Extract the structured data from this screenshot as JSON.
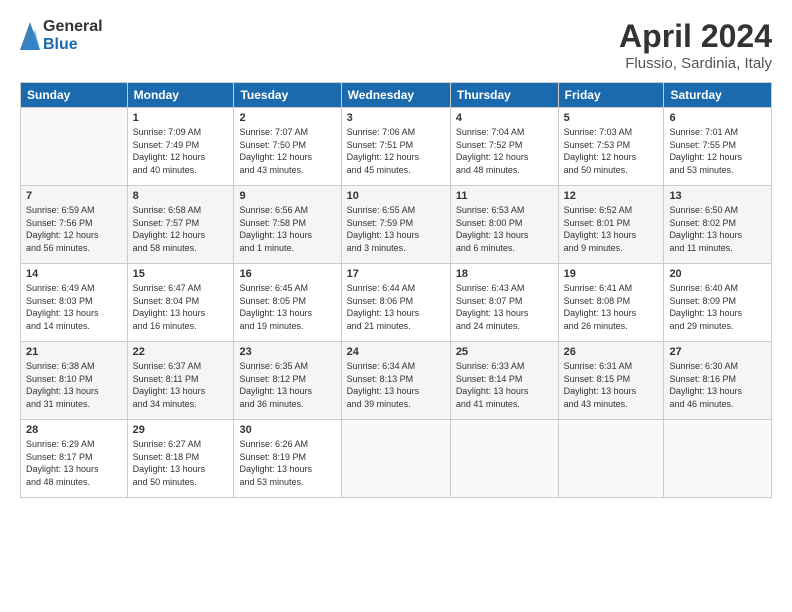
{
  "logo": {
    "general": "General",
    "blue": "Blue"
  },
  "title": "April 2024",
  "location": "Flussio, Sardinia, Italy",
  "days_header": [
    "Sunday",
    "Monday",
    "Tuesday",
    "Wednesday",
    "Thursday",
    "Friday",
    "Saturday"
  ],
  "weeks": [
    [
      {
        "day": "",
        "info": ""
      },
      {
        "day": "1",
        "info": "Sunrise: 7:09 AM\nSunset: 7:49 PM\nDaylight: 12 hours\nand 40 minutes."
      },
      {
        "day": "2",
        "info": "Sunrise: 7:07 AM\nSunset: 7:50 PM\nDaylight: 12 hours\nand 43 minutes."
      },
      {
        "day": "3",
        "info": "Sunrise: 7:06 AM\nSunset: 7:51 PM\nDaylight: 12 hours\nand 45 minutes."
      },
      {
        "day": "4",
        "info": "Sunrise: 7:04 AM\nSunset: 7:52 PM\nDaylight: 12 hours\nand 48 minutes."
      },
      {
        "day": "5",
        "info": "Sunrise: 7:03 AM\nSunset: 7:53 PM\nDaylight: 12 hours\nand 50 minutes."
      },
      {
        "day": "6",
        "info": "Sunrise: 7:01 AM\nSunset: 7:55 PM\nDaylight: 12 hours\nand 53 minutes."
      }
    ],
    [
      {
        "day": "7",
        "info": "Sunrise: 6:59 AM\nSunset: 7:56 PM\nDaylight: 12 hours\nand 56 minutes."
      },
      {
        "day": "8",
        "info": "Sunrise: 6:58 AM\nSunset: 7:57 PM\nDaylight: 12 hours\nand 58 minutes."
      },
      {
        "day": "9",
        "info": "Sunrise: 6:56 AM\nSunset: 7:58 PM\nDaylight: 13 hours\nand 1 minute."
      },
      {
        "day": "10",
        "info": "Sunrise: 6:55 AM\nSunset: 7:59 PM\nDaylight: 13 hours\nand 3 minutes."
      },
      {
        "day": "11",
        "info": "Sunrise: 6:53 AM\nSunset: 8:00 PM\nDaylight: 13 hours\nand 6 minutes."
      },
      {
        "day": "12",
        "info": "Sunrise: 6:52 AM\nSunset: 8:01 PM\nDaylight: 13 hours\nand 9 minutes."
      },
      {
        "day": "13",
        "info": "Sunrise: 6:50 AM\nSunset: 8:02 PM\nDaylight: 13 hours\nand 11 minutes."
      }
    ],
    [
      {
        "day": "14",
        "info": "Sunrise: 6:49 AM\nSunset: 8:03 PM\nDaylight: 13 hours\nand 14 minutes."
      },
      {
        "day": "15",
        "info": "Sunrise: 6:47 AM\nSunset: 8:04 PM\nDaylight: 13 hours\nand 16 minutes."
      },
      {
        "day": "16",
        "info": "Sunrise: 6:45 AM\nSunset: 8:05 PM\nDaylight: 13 hours\nand 19 minutes."
      },
      {
        "day": "17",
        "info": "Sunrise: 6:44 AM\nSunset: 8:06 PM\nDaylight: 13 hours\nand 21 minutes."
      },
      {
        "day": "18",
        "info": "Sunrise: 6:43 AM\nSunset: 8:07 PM\nDaylight: 13 hours\nand 24 minutes."
      },
      {
        "day": "19",
        "info": "Sunrise: 6:41 AM\nSunset: 8:08 PM\nDaylight: 13 hours\nand 26 minutes."
      },
      {
        "day": "20",
        "info": "Sunrise: 6:40 AM\nSunset: 8:09 PM\nDaylight: 13 hours\nand 29 minutes."
      }
    ],
    [
      {
        "day": "21",
        "info": "Sunrise: 6:38 AM\nSunset: 8:10 PM\nDaylight: 13 hours\nand 31 minutes."
      },
      {
        "day": "22",
        "info": "Sunrise: 6:37 AM\nSunset: 8:11 PM\nDaylight: 13 hours\nand 34 minutes."
      },
      {
        "day": "23",
        "info": "Sunrise: 6:35 AM\nSunset: 8:12 PM\nDaylight: 13 hours\nand 36 minutes."
      },
      {
        "day": "24",
        "info": "Sunrise: 6:34 AM\nSunset: 8:13 PM\nDaylight: 13 hours\nand 39 minutes."
      },
      {
        "day": "25",
        "info": "Sunrise: 6:33 AM\nSunset: 8:14 PM\nDaylight: 13 hours\nand 41 minutes."
      },
      {
        "day": "26",
        "info": "Sunrise: 6:31 AM\nSunset: 8:15 PM\nDaylight: 13 hours\nand 43 minutes."
      },
      {
        "day": "27",
        "info": "Sunrise: 6:30 AM\nSunset: 8:16 PM\nDaylight: 13 hours\nand 46 minutes."
      }
    ],
    [
      {
        "day": "28",
        "info": "Sunrise: 6:29 AM\nSunset: 8:17 PM\nDaylight: 13 hours\nand 48 minutes."
      },
      {
        "day": "29",
        "info": "Sunrise: 6:27 AM\nSunset: 8:18 PM\nDaylight: 13 hours\nand 50 minutes."
      },
      {
        "day": "30",
        "info": "Sunrise: 6:26 AM\nSunset: 8:19 PM\nDaylight: 13 hours\nand 53 minutes."
      },
      {
        "day": "",
        "info": ""
      },
      {
        "day": "",
        "info": ""
      },
      {
        "day": "",
        "info": ""
      },
      {
        "day": "",
        "info": ""
      }
    ]
  ]
}
